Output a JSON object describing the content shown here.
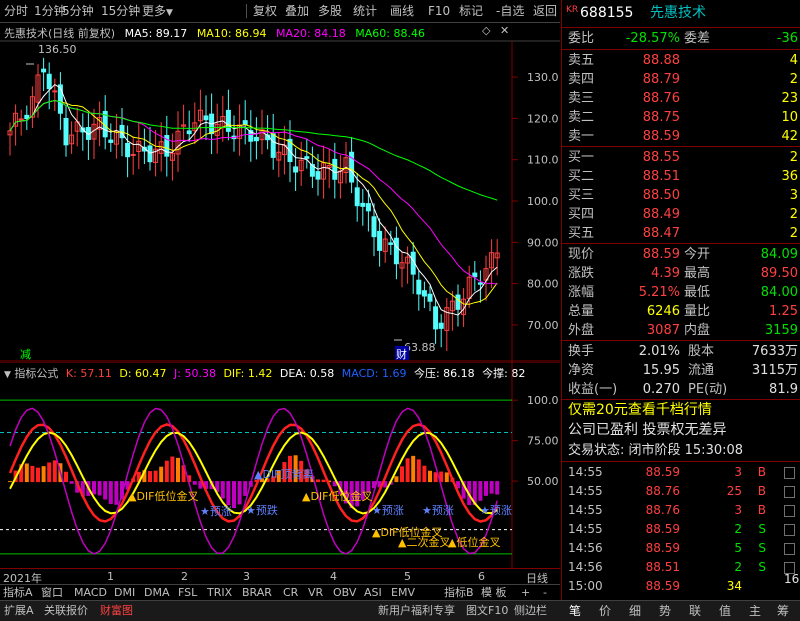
{
  "toolbar": {
    "left_items": [
      "分时",
      "1分钟",
      "5分钟",
      "15分钟",
      "更多"
    ],
    "right_items": [
      "复权",
      "叠加",
      "多股",
      "统计",
      "画线",
      "F10",
      "标记",
      "-自选",
      "返回"
    ]
  },
  "main_chart": {
    "title": "先惠技术(日线 前复权)",
    "ma5_label": "MA5: 89.17",
    "ma10_label": "MA10: 86.94",
    "ma20_label": "MA20: 84.18",
    "ma60_label": "MA60: 88.46",
    "y_ticks": [
      "130.0",
      "120.0",
      "110.0",
      "100.0",
      "90.00",
      "80.00",
      "70.00"
    ],
    "high_annotation": "136.50",
    "low_annotation": "63.88",
    "marker_left": "减",
    "marker_low": "财",
    "colors": {
      "ma5": "#ffffff",
      "ma10": "#ffff00",
      "ma20": "#ff00ff",
      "ma60": "#00ff00",
      "up": "#ff4040",
      "down": "#54fcfc"
    }
  },
  "indicator": {
    "title": "指标公式",
    "k": "K: 57.11",
    "d": "D: 60.47",
    "j": "J: 50.38",
    "dif": "DIF: 1.42",
    "dea": "DEA: 0.58",
    "macd": "MACD: 1.69",
    "pressure": "今压: 86.18",
    "support": "今撑: 82",
    "y_ticks": [
      "100.0",
      "75.00",
      "50.00"
    ],
    "annotations": [
      "DIF低位金叉",
      "DIF顶背离",
      "DIF低位金叉",
      "DIF低位金叉",
      "二次金叉",
      "低位金叉"
    ],
    "forecast_labels": [
      "预涨",
      "预跌",
      "预涨",
      "预涨",
      "预涨"
    ]
  },
  "x_axis": {
    "year_label": "2021年",
    "months": [
      "1",
      "2",
      "3",
      "4",
      "5",
      "6"
    ],
    "right_label": "日线"
  },
  "bottom_tabs": [
    "指标A",
    "窗口",
    "MACD",
    "DMI",
    "DMA",
    "FSL",
    "TRIX",
    "BRAR",
    "CR",
    "VR",
    "OBV",
    "ASI",
    "EMV"
  ],
  "bottom_right_tabs": [
    "指标B",
    "模 板",
    "+",
    "-"
  ],
  "footer": {
    "left": [
      "扩展A",
      "关联报价",
      "财富图"
    ],
    "right": [
      "新用户福利专享",
      "图文F10",
      "侧边栏"
    ]
  },
  "right_panel": {
    "code": "688155",
    "name": "先惠技术",
    "weibi_label": "委比",
    "weibi_value": "-28.57%",
    "weicha_label": "委差",
    "weicha_value": "-36",
    "sells": [
      {
        "label": "卖五",
        "price": "88.88",
        "vol": "4"
      },
      {
        "label": "卖四",
        "price": "88.79",
        "vol": "2"
      },
      {
        "label": "卖三",
        "price": "88.76",
        "vol": "23"
      },
      {
        "label": "卖二",
        "price": "88.75",
        "vol": "10"
      },
      {
        "label": "卖一",
        "price": "88.59",
        "vol": "42"
      }
    ],
    "buys": [
      {
        "label": "买一",
        "price": "88.55",
        "vol": "2"
      },
      {
        "label": "买二",
        "price": "88.51",
        "vol": "36"
      },
      {
        "label": "买三",
        "price": "88.50",
        "vol": "3"
      },
      {
        "label": "买四",
        "price": "88.49",
        "vol": "2"
      },
      {
        "label": "买五",
        "price": "88.47",
        "vol": "2"
      }
    ],
    "quote": [
      {
        "l1": "现价",
        "v1": "88.59",
        "l2": "今开",
        "v2": "84.09"
      },
      {
        "l1": "涨跌",
        "v1": "4.39",
        "l2": "最高",
        "v2": "89.50"
      },
      {
        "l1": "涨幅",
        "v1": "5.21%",
        "l2": "最低",
        "v2": "84.00"
      },
      {
        "l1": "总量",
        "v1": "6246",
        "l2": "量比",
        "v2": "1.25"
      },
      {
        "l1": "外盘",
        "v1": "3087",
        "l2": "内盘",
        "v2": "3159"
      }
    ],
    "stats": [
      {
        "l1": "换手",
        "v1": "2.01%",
        "l2": "股本",
        "v2": "7633万"
      },
      {
        "l1": "净资",
        "v1": "15.95",
        "l2": "流通",
        "v2": "3115万"
      },
      {
        "l1": "收益(一)",
        "v1": "0.270",
        "l2": "PE(动)",
        "v2": "81.9"
      }
    ],
    "promo": "仅需20元查看千档行情",
    "notice": "公司已盈利 投票权无差异",
    "status": "交易状态: 闭市阶段 15:30:08",
    "ticks": [
      {
        "time": "14:55",
        "price": "88.59",
        "vol": "3",
        "side": "B"
      },
      {
        "time": "14:55",
        "price": "88.76",
        "vol": "25",
        "side": "B"
      },
      {
        "time": "14:55",
        "price": "88.76",
        "vol": "3",
        "side": "B"
      },
      {
        "time": "14:55",
        "price": "88.59",
        "vol": "2",
        "side": "S"
      },
      {
        "time": "14:56",
        "price": "88.59",
        "vol": "5",
        "side": "S"
      },
      {
        "time": "14:56",
        "price": "88.51",
        "vol": "2",
        "side": "S"
      },
      {
        "time": "15:00",
        "price": "88.59",
        "vol": "34",
        "side": ""
      }
    ],
    "tick_last_right": "16",
    "bottom_tabs": [
      "笔",
      "价",
      "细",
      "势",
      "联",
      "值",
      "主",
      "筹"
    ]
  }
}
